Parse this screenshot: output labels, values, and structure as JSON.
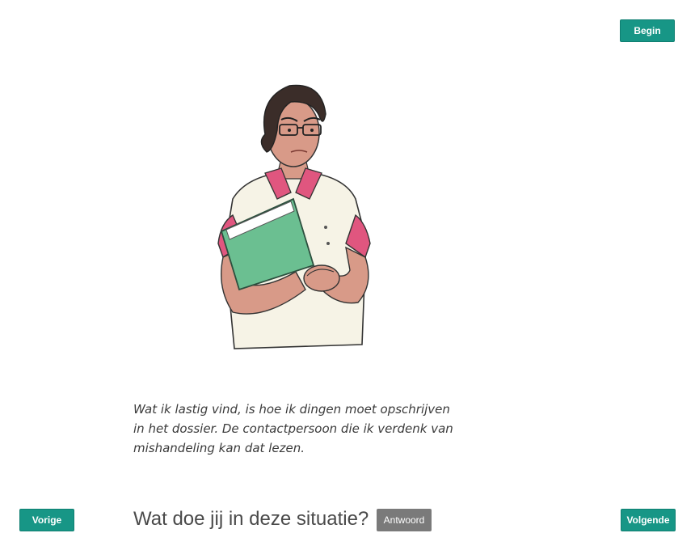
{
  "nav": {
    "begin_label": "Begin",
    "previous_label": "Vorige",
    "next_label": "Volgende"
  },
  "scene": {
    "illustration_icon": "nurse-illustration",
    "quote_lines": [
      "Wat ik lastig vind, is hoe ik dingen moet opschrijven",
      "in het dossier. De contactpersoon die ik verdenk van",
      "mishandeling kan dat lezen."
    ]
  },
  "prompt": {
    "question": "Wat doe jij in deze situatie?",
    "answer_label": "Antwoord"
  },
  "colors": {
    "accent": "#179686",
    "answer_button": "#7a7a7a",
    "folder": "#6bbf91",
    "uniform_trim": "#e0567f"
  }
}
